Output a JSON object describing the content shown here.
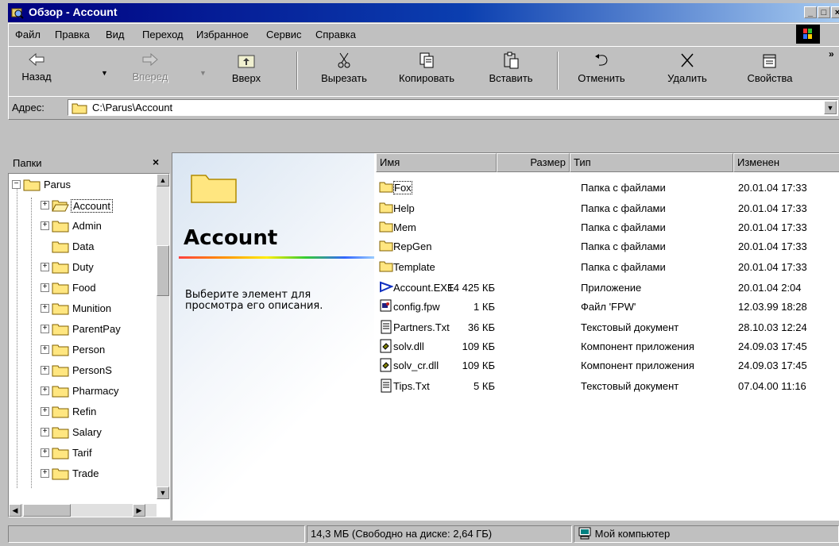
{
  "window": {
    "title": "Обзор - Account"
  },
  "menu": {
    "items": [
      "Файл",
      "Правка",
      "Вид",
      "Переход",
      "Избранное",
      "Сервис",
      "Справка"
    ]
  },
  "toolbar": {
    "back": "Назад",
    "forward": "Вперед",
    "up": "Вверх",
    "cut": "Вырезать",
    "copy": "Копировать",
    "paste": "Вставить",
    "undo": "Отменить",
    "delete": "Удалить",
    "properties": "Свойства",
    "more": "»"
  },
  "address": {
    "label": "Адрес:",
    "value": "C:\\Parus\\Account"
  },
  "folders_pane": {
    "title": "Папки",
    "close": "×",
    "tree": [
      {
        "label": "Parus",
        "expander": "−"
      },
      {
        "label": "Account",
        "expander": "+"
      },
      {
        "label": "Admin",
        "expander": "+"
      },
      {
        "label": "Data",
        "expander": ""
      },
      {
        "label": "Duty",
        "expander": "+"
      },
      {
        "label": "Food",
        "expander": "+"
      },
      {
        "label": "Munition",
        "expander": "+"
      },
      {
        "label": "ParentPay",
        "expander": "+"
      },
      {
        "label": "Person",
        "expander": "+"
      },
      {
        "label": "PersonS",
        "expander": "+"
      },
      {
        "label": "Pharmacy",
        "expander": "+"
      },
      {
        "label": "Refin",
        "expander": "+"
      },
      {
        "label": "Salary",
        "expander": "+"
      },
      {
        "label": "Tarif",
        "expander": "+"
      },
      {
        "label": "Trade",
        "expander": "+"
      }
    ]
  },
  "webview": {
    "title": "Account",
    "description": "Выберите элемент для просмотра его описания."
  },
  "columns": {
    "name": "Имя",
    "size": "Размер",
    "type": "Тип",
    "modified": "Изменен"
  },
  "files": [
    {
      "name": "Fox",
      "size": "",
      "type": "Папка с файлами",
      "modified": "20.01.04 17:33",
      "icon": "folder"
    },
    {
      "name": "Help",
      "size": "",
      "type": "Папка с файлами",
      "modified": "20.01.04 17:33",
      "icon": "folder"
    },
    {
      "name": "Mem",
      "size": "",
      "type": "Папка с файлами",
      "modified": "20.01.04 17:33",
      "icon": "folder"
    },
    {
      "name": "RepGen",
      "size": "",
      "type": "Папка с файлами",
      "modified": "20.01.04 17:33",
      "icon": "folder"
    },
    {
      "name": "Template",
      "size": "",
      "type": "Папка с файлами",
      "modified": "20.01.04 17:33",
      "icon": "folder"
    },
    {
      "name": "Account.EXE",
      "size": "14 425 КБ",
      "type": "Приложение",
      "modified": "20.01.04 2:04",
      "icon": "exe"
    },
    {
      "name": "config.fpw",
      "size": "1 КБ",
      "type": "Файл 'FPW'",
      "modified": "12.03.99 18:28",
      "icon": "fpw"
    },
    {
      "name": "Partners.Txt",
      "size": "36 КБ",
      "type": "Текстовый документ",
      "modified": "28.10.03 12:24",
      "icon": "txt"
    },
    {
      "name": "solv.dll",
      "size": "109 КБ",
      "type": "Компонент приложения",
      "modified": "24.09.03 17:45",
      "icon": "dll"
    },
    {
      "name": "solv_cr.dll",
      "size": "109 КБ",
      "type": "Компонент приложения",
      "modified": "24.09.03 17:45",
      "icon": "dll"
    },
    {
      "name": "Tips.Txt",
      "size": "5 КБ",
      "type": "Текстовый документ",
      "modified": "07.04.00 11:16",
      "icon": "txt"
    }
  ],
  "status": {
    "space": "14,3 МБ (Свободно на диске: 2,64 ГБ)",
    "location": "Мой компьютер"
  }
}
